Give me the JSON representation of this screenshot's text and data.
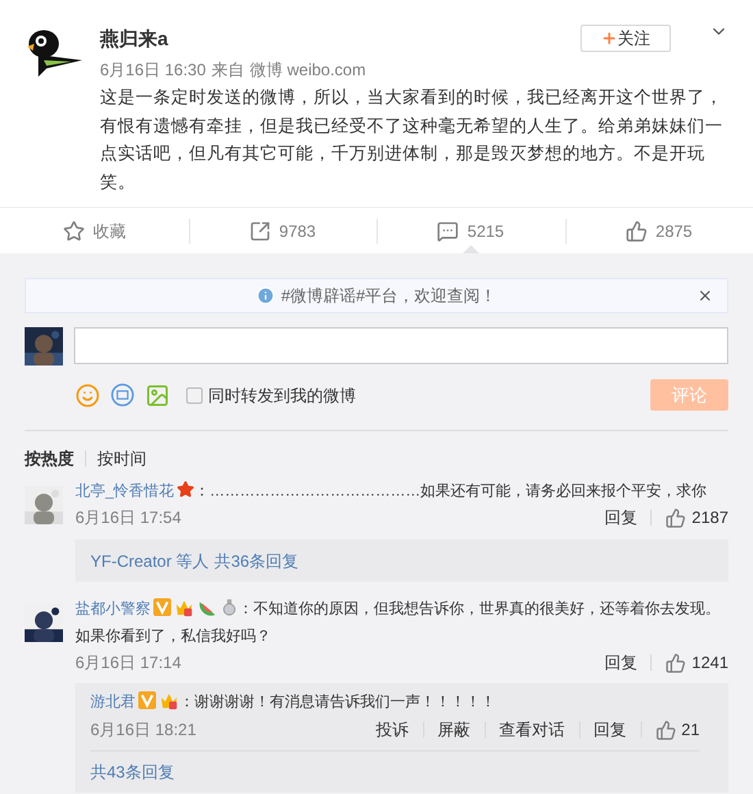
{
  "post": {
    "author": "燕归来a",
    "date": "6月16日 16:30",
    "source_prefix": "来自",
    "source": "微博 weibo.com",
    "follow_button": "关注",
    "text": "这是一条定时发送的微博，所以，当大家看到的时候，我已经离开这个世界了，有恨有遗憾有牵挂，但是我已经受不了这种毫无希望的人生了。给弟弟妹妹们一点实话吧，但凡有其它可能，千万别进体制，那是毁灭梦想的地方。不是开玩笑。",
    "actions": [
      {
        "kind": "favorite",
        "label": "收藏",
        "selected": false
      },
      {
        "kind": "repost",
        "label": "9783",
        "selected": false
      },
      {
        "kind": "comment",
        "label": "5215",
        "selected": true
      },
      {
        "kind": "like",
        "label": "2875",
        "selected": false
      }
    ]
  },
  "notice": {
    "text": "#微博辟谣#平台，欢迎查阅！"
  },
  "composer": {
    "checkbox": {
      "label": "同时转发到我的微博",
      "checked": false
    },
    "submit": "评论"
  },
  "sort_tabs": [
    {
      "label": "按热度",
      "selected": true
    },
    {
      "label": "按时间",
      "selected": false
    }
  ],
  "comments": [
    {
      "author": "北亭_怜香惜花",
      "badges": [
        {
          "kind": "star"
        }
      ],
      "text": "：……………………………………如果还有可能，请务必回来报个平安，求你",
      "time": "6月16日 17:54",
      "reply": "回复",
      "likes": "2187",
      "summary": {
        "users": "YF-Creator 等人",
        "count": "共36条回复"
      }
    },
    {
      "author": "盐都小警察",
      "badges": [
        {
          "kind": "verified"
        },
        {
          "kind": "crown"
        },
        {
          "kind": "melon"
        },
        {
          "kind": "medal"
        }
      ],
      "text": "：不知道你的原因，但我想告诉你，世界真的很美好，还等着你去发现。如果你看到了，私信我好吗？",
      "time": "6月16日 17:14",
      "reply": "回复",
      "likes": "1241",
      "sub_replies": [
        {
          "author": "游北君",
          "badges": [
            {
              "kind": "verified"
            },
            {
              "kind": "crown"
            }
          ],
          "text": "：谢谢谢谢！有消息请告诉我们一声！！！！！",
          "time": "6月16日 18:21",
          "actions": [
            "投诉",
            "屏蔽",
            "查看对话",
            "回复"
          ],
          "likes": "21"
        }
      ],
      "more": "共43条回复"
    }
  ]
}
